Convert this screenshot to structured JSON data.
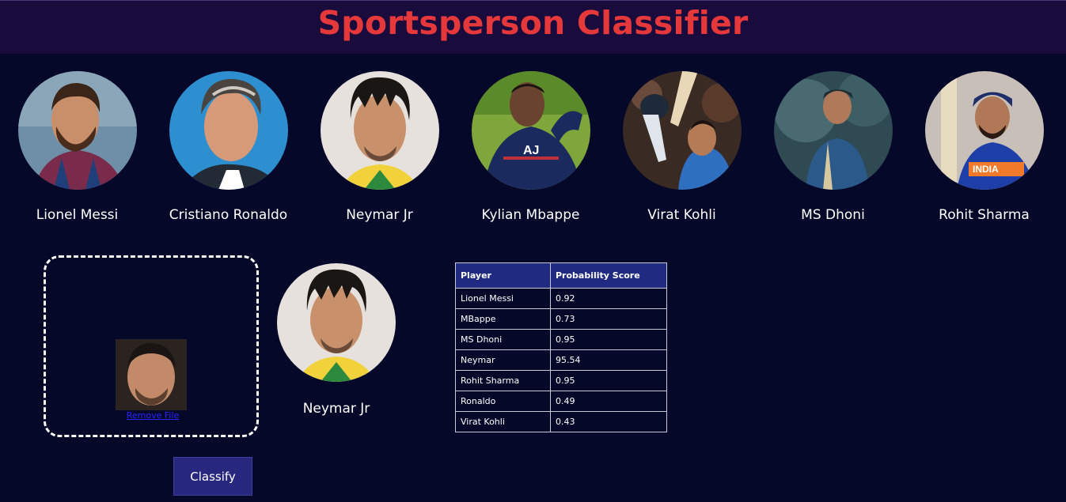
{
  "header": {
    "title": "Sportsperson Classifier",
    "title_color": "#e5383b",
    "background": "#1a0b3d"
  },
  "players": [
    {
      "name": "Lionel Messi",
      "photo": "messi-photo"
    },
    {
      "name": "Cristiano Ronaldo",
      "photo": "ronaldo-photo"
    },
    {
      "name": "Neymar Jr",
      "photo": "neymar-photo"
    },
    {
      "name": "Kylian Mbappe",
      "photo": "mbappe-photo"
    },
    {
      "name": "Virat Kohli",
      "photo": "kohli-photo"
    },
    {
      "name": "MS Dhoni",
      "photo": "dhoni-photo"
    },
    {
      "name": "Rohit Sharma",
      "photo": "rohit-photo"
    }
  ],
  "upload": {
    "remove_label": "Remove File",
    "thumbnail": "uploaded-face-photo"
  },
  "classify_button": {
    "label": "Classify",
    "color": "#27277e"
  },
  "result": {
    "name": "Neymar Jr",
    "photo": "neymar-photo"
  },
  "probability_table": {
    "headers": [
      "Player",
      "Probability Score"
    ],
    "rows": [
      {
        "player": "Lionel Messi",
        "score": "0.92"
      },
      {
        "player": "MBappe",
        "score": "0.73"
      },
      {
        "player": "MS Dhoni",
        "score": "0.95"
      },
      {
        "player": "Neymar",
        "score": "95.54"
      },
      {
        "player": "Rohit Sharma",
        "score": "0.95"
      },
      {
        "player": "Ronaldo",
        "score": "0.49"
      },
      {
        "player": "Virat Kohli",
        "score": "0.43"
      }
    ]
  }
}
